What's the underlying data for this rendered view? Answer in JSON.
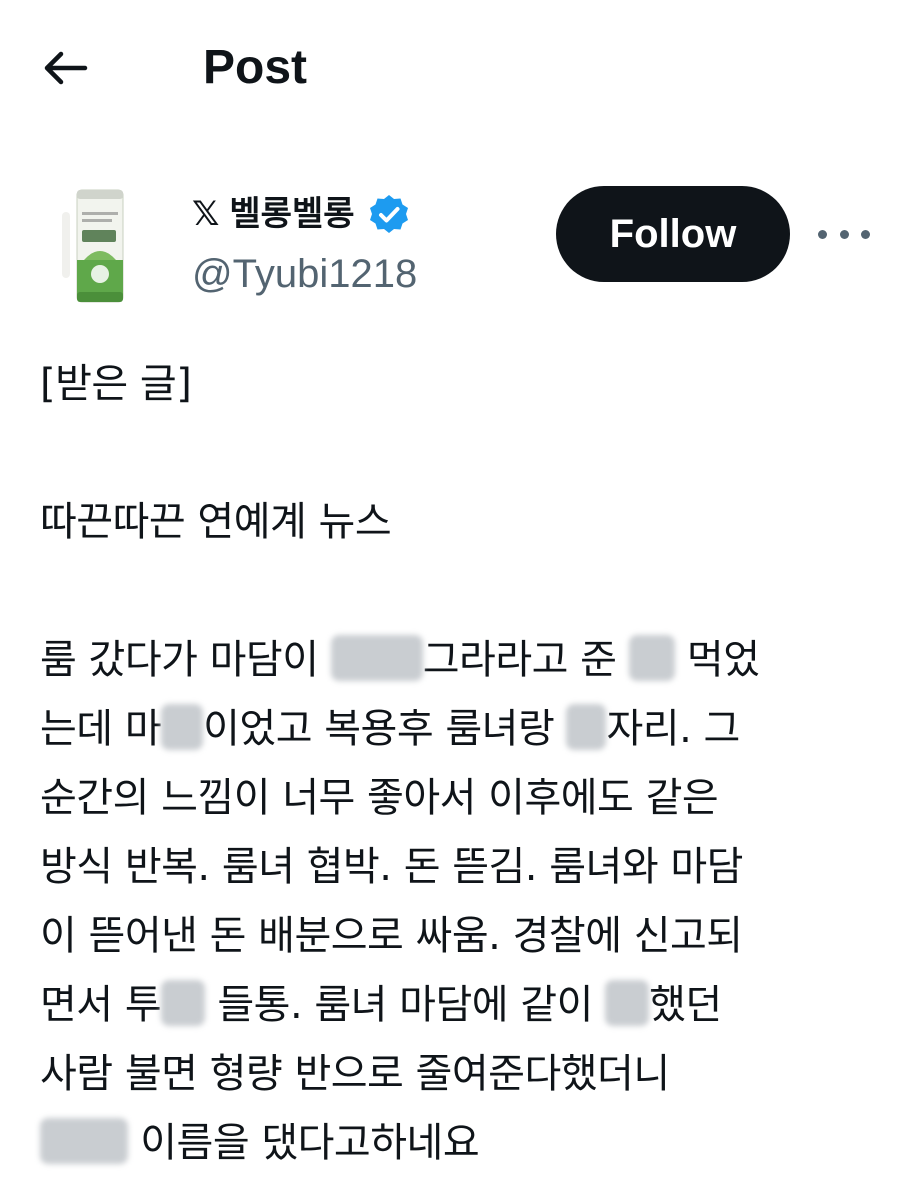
{
  "header": {
    "title": "Post",
    "back_icon": "arrow-left-icon"
  },
  "author": {
    "display_name": "벨롱벨롱",
    "handle": "@Tyubi1218",
    "badge": "𝕏",
    "verified_icon": "verified-badge-icon",
    "avatar_icon": "aloe-drink-can-avatar"
  },
  "actions": {
    "follow_label": "Follow",
    "more_icon": "more-horizontal-icon"
  },
  "post": {
    "line1": "[받은 글]",
    "line2": "따끈따끈 연예계 뉴스",
    "l3a": "룸 갔다가 마담이 ",
    "l3b": "그라라고 준 ",
    "l3c": " 먹었",
    "l4a": "는데 마",
    "l4b": "이었고 복용후 룸녀랑 ",
    "l4c": "자리. 그",
    "l5": "순간의 느낌이 너무 좋아서 이후에도 같은",
    "l6": "방식 반복. 룸녀 협박. 돈 뜯김. 룸녀와 마담",
    "l7": "이 뜯어낸 돈 배분으로 싸움. 경찰에 신고되",
    "l8a": "면서 투",
    "l8b": " 들통. 룸녀 마담에 같이 ",
    "l8c": "했던",
    "l9": "사람 불면 형량 반으로 줄여준다했더니",
    "l10a": " 이름을 댔다고하네요"
  },
  "colors": {
    "text": "#0f1419",
    "secondary": "#536471",
    "verified": "#1d9bf0",
    "follow_bg": "#0f1419"
  }
}
